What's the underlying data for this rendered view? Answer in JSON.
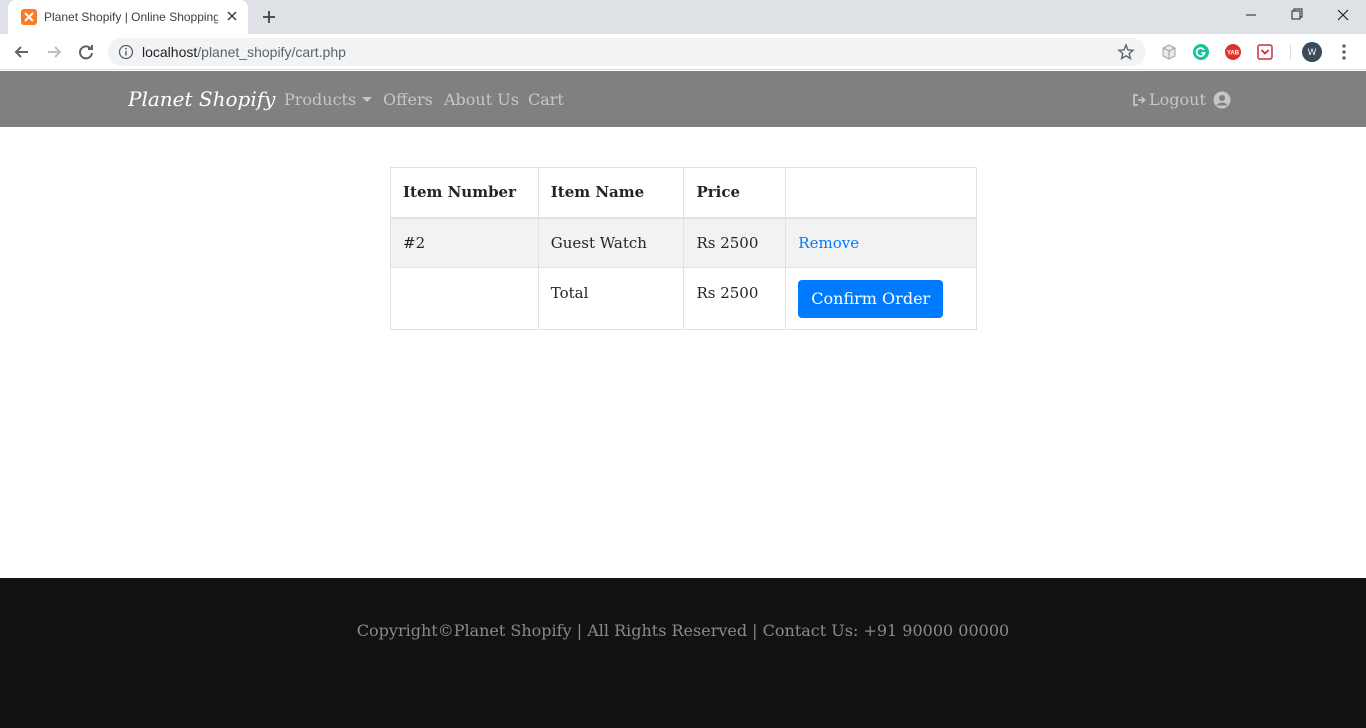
{
  "browser": {
    "tab_title": "Planet Shopify | Online Shopping",
    "url_host": "localhost",
    "url_path": "/planet_shopify/cart.php",
    "profile_initial": "W",
    "extensions": [
      "cube-extension",
      "grammarly-extension",
      "yab-extension",
      "pocket-extension"
    ]
  },
  "navbar": {
    "brand": "Planet Shopify",
    "links": [
      "Products",
      "Offers",
      "About Us",
      "Cart"
    ],
    "logout": "Logout"
  },
  "cart": {
    "headers": [
      "Item Number",
      "Item Name",
      "Price",
      ""
    ],
    "rows": [
      {
        "number": "#2",
        "name": "Guest Watch",
        "price": "Rs 2500",
        "action": "Remove"
      }
    ],
    "total_label": "Total",
    "total_price": "Rs 2500",
    "confirm_label": "Confirm Order"
  },
  "footer": {
    "text": "Copyright©Planet Shopify | All Rights Reserved | Contact Us: +91 90000 00000"
  },
  "colors": {
    "navbar_bg": "#808080",
    "footer_bg": "#121212",
    "accent": "#007bff"
  }
}
